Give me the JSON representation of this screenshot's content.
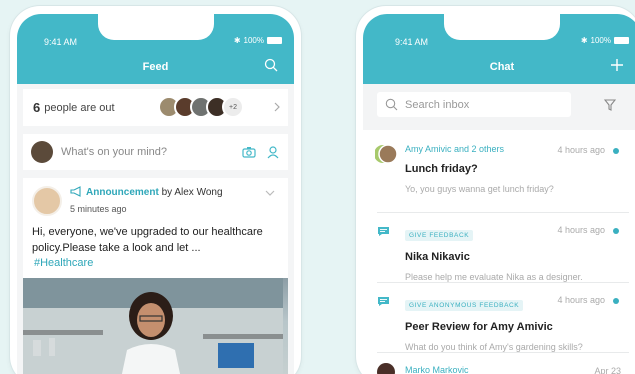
{
  "feed": {
    "status": {
      "time": "9:41 AM",
      "battery": "100%"
    },
    "title": "Feed",
    "people_out": {
      "count": "6",
      "label": "people are out",
      "more": "+2"
    },
    "compose": {
      "placeholder": "What's on your mind?"
    },
    "post": {
      "type_label": "Announcement",
      "by": "by Alex Wong",
      "time": "5 minutes ago",
      "body": "Hi, everyone, we've upgraded to our healthcare policy.Please take a look and let ...",
      "hashtag": "#Healthcare"
    }
  },
  "chat": {
    "status": {
      "time": "9:41 AM",
      "battery": "100%"
    },
    "title": "Chat",
    "search": {
      "placeholder": "Search inbox"
    },
    "items": [
      {
        "from": "Amy Amivic and 2 others",
        "time": "4 hours ago",
        "subject": "Lunch friday?",
        "preview": "Yo, you guys wanna get lunch friday?"
      },
      {
        "tag": "GIVE FEEDBACK",
        "time": "4 hours ago",
        "subject": "Nika Nikavic",
        "preview": "Please help me evaluate Nika as a designer."
      },
      {
        "tag": "GIVE ANONYMOUS FEEDBACK",
        "time": "4 hours ago",
        "subject": "Peer Review for Amy Amivic",
        "preview": "What do you think of Amy's gardening skills?"
      },
      {
        "from": "Marko Markovic",
        "time": "Apr 23"
      }
    ]
  },
  "colors": {
    "accent": "#43b8c8",
    "link": "#2fa7b9"
  }
}
